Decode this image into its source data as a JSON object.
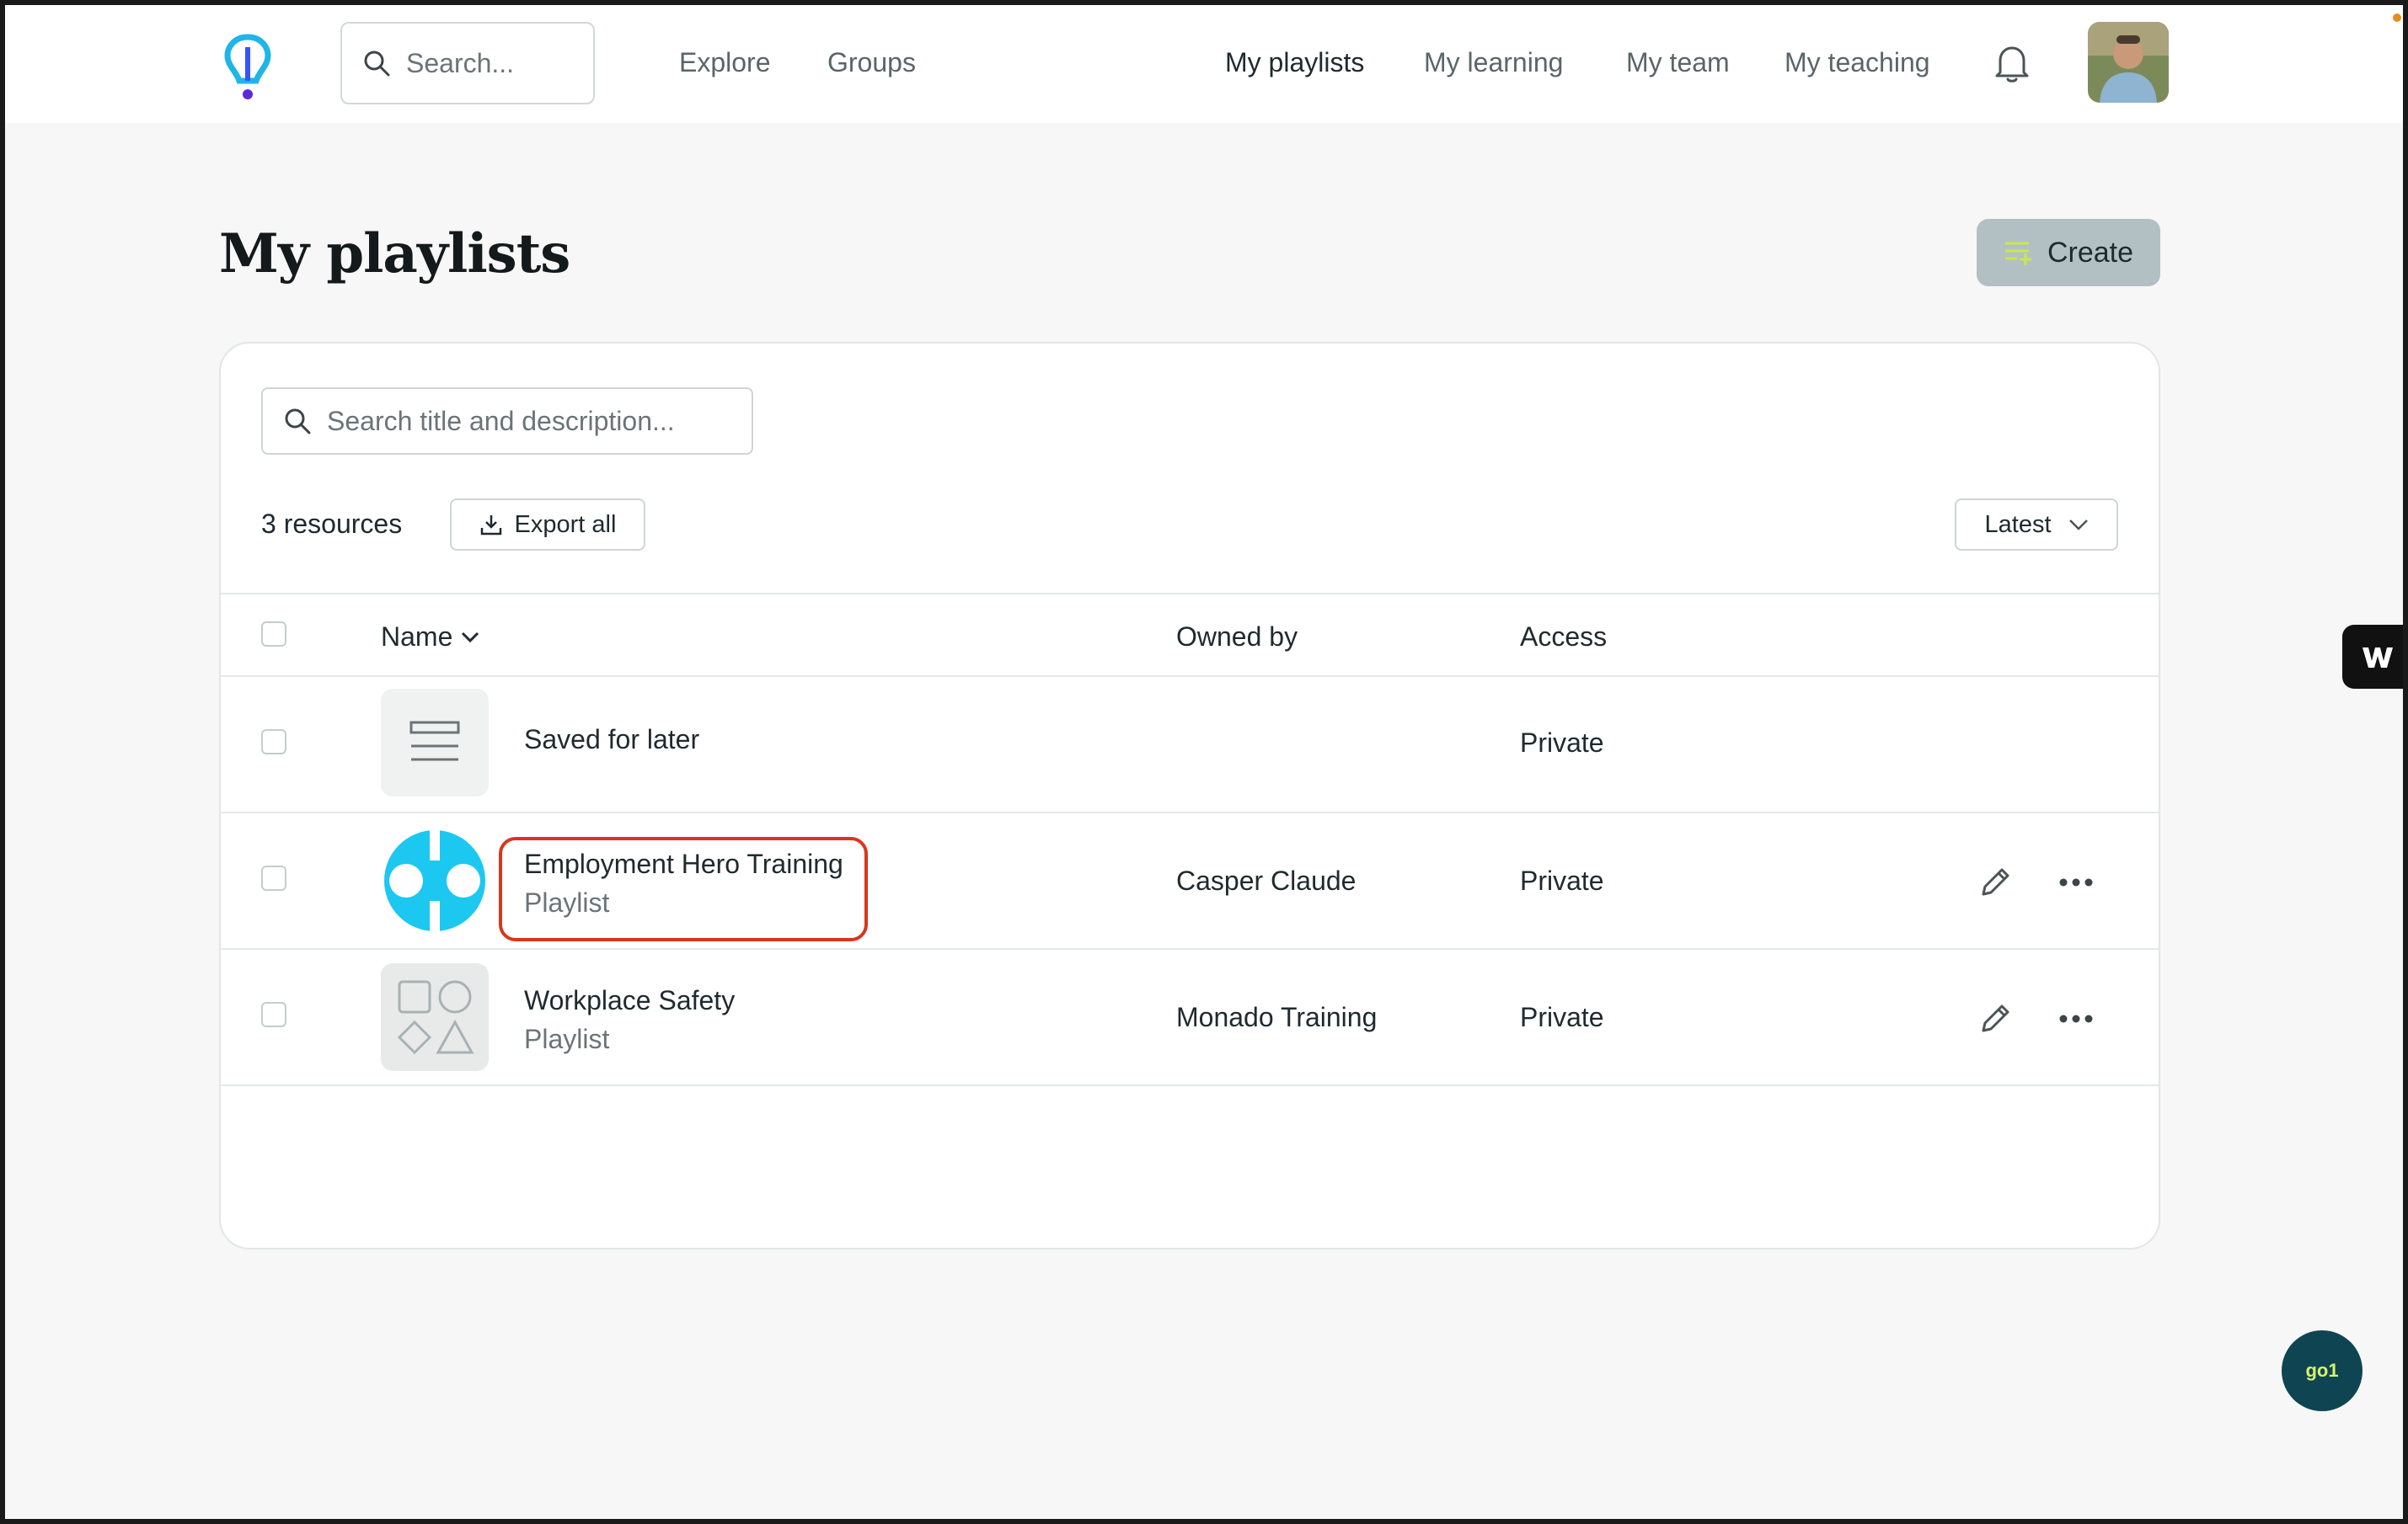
{
  "nav": {
    "search_placeholder": "Search...",
    "links": [
      "Explore",
      "Groups"
    ],
    "right_links": [
      "My playlists",
      "My learning",
      "My team",
      "My teaching"
    ],
    "active_link": "My playlists"
  },
  "page": {
    "title": "My playlists",
    "create_label": "Create"
  },
  "toolbar": {
    "search_placeholder": "Search title and description...",
    "count_label": "3 resources",
    "export_label": "Export all",
    "sort_label": "Latest"
  },
  "table": {
    "headers": {
      "name": "Name",
      "owner": "Owned by",
      "access": "Access"
    },
    "rows": [
      {
        "title": "Saved for later",
        "subtitle": "",
        "owner": "",
        "access": "Private",
        "thumb": "list-icon"
      },
      {
        "title": "Employment Hero Training",
        "subtitle": "Playlist",
        "owner": "Casper Claude",
        "access": "Private",
        "thumb": "employment-hero-logo"
      },
      {
        "title": "Workplace Safety",
        "subtitle": "Playlist",
        "owner": "Monado Training",
        "access": "Private",
        "thumb": "shapes-icon"
      }
    ]
  },
  "widgets": {
    "chat_label": "go1"
  },
  "colors": {
    "accent_cyan": "#1cc8f0",
    "highlight_red": "#d9361e",
    "create_bg": "#b3c0c3",
    "chat_bg": "#0f4552"
  }
}
